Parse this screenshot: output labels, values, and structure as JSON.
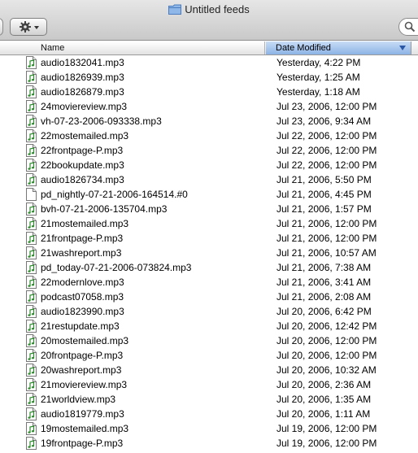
{
  "window": {
    "title": "Untitled feeds"
  },
  "toolbar": {
    "action_icon": "gear-icon",
    "search_icon": "search-icon"
  },
  "columns": {
    "name": "Name",
    "date_modified": "Date Modified",
    "sorted_by": "date_modified",
    "sort_direction": "descending"
  },
  "colors": {
    "sorted_column_header": "#8cb3e6",
    "audio_icon_accent": "#2e8b2e"
  },
  "files": [
    {
      "name": "audio1832041.mp3",
      "date": "Yesterday, 4:22 PM",
      "kind": "audio"
    },
    {
      "name": "audio1826939.mp3",
      "date": "Yesterday, 1:25 AM",
      "kind": "audio"
    },
    {
      "name": "audio1826879.mp3",
      "date": "Yesterday, 1:18 AM",
      "kind": "audio"
    },
    {
      "name": "24moviereview.mp3",
      "date": "Jul 23, 2006, 12:00 PM",
      "kind": "audio"
    },
    {
      "name": "vh-07-23-2006-093338.mp3",
      "date": "Jul 23, 2006, 9:34 AM",
      "kind": "audio"
    },
    {
      "name": "22mostemailed.mp3",
      "date": "Jul 22, 2006, 12:00 PM",
      "kind": "audio"
    },
    {
      "name": "22frontpage-P.mp3",
      "date": "Jul 22, 2006, 12:00 PM",
      "kind": "audio"
    },
    {
      "name": "22bookupdate.mp3",
      "date": "Jul 22, 2006, 12:00 PM",
      "kind": "audio"
    },
    {
      "name": "audio1826734.mp3",
      "date": "Jul 21, 2006, 5:50 PM",
      "kind": "audio"
    },
    {
      "name": "pd_nightly-07-21-2006-164514.#0",
      "date": "Jul 21, 2006, 4:45 PM",
      "kind": "document"
    },
    {
      "name": "bvh-07-21-2006-135704.mp3",
      "date": "Jul 21, 2006, 1:57 PM",
      "kind": "audio"
    },
    {
      "name": "21mostemailed.mp3",
      "date": "Jul 21, 2006, 12:00 PM",
      "kind": "audio"
    },
    {
      "name": "21frontpage-P.mp3",
      "date": "Jul 21, 2006, 12:00 PM",
      "kind": "audio"
    },
    {
      "name": "21washreport.mp3",
      "date": "Jul 21, 2006, 10:57 AM",
      "kind": "audio"
    },
    {
      "name": "pd_today-07-21-2006-073824.mp3",
      "date": "Jul 21, 2006, 7:38 AM",
      "kind": "audio"
    },
    {
      "name": "22modernlove.mp3",
      "date": "Jul 21, 2006, 3:41 AM",
      "kind": "audio"
    },
    {
      "name": "podcast07058.mp3",
      "date": "Jul 21, 2006, 2:08 AM",
      "kind": "audio"
    },
    {
      "name": "audio1823990.mp3",
      "date": "Jul 20, 2006, 6:42 PM",
      "kind": "audio"
    },
    {
      "name": "21restupdate.mp3",
      "date": "Jul 20, 2006, 12:42 PM",
      "kind": "audio"
    },
    {
      "name": "20mostemailed.mp3",
      "date": "Jul 20, 2006, 12:00 PM",
      "kind": "audio"
    },
    {
      "name": "20frontpage-P.mp3",
      "date": "Jul 20, 2006, 12:00 PM",
      "kind": "audio"
    },
    {
      "name": "20washreport.mp3",
      "date": "Jul 20, 2006, 10:32 AM",
      "kind": "audio"
    },
    {
      "name": "21moviereview.mp3",
      "date": "Jul 20, 2006, 2:36 AM",
      "kind": "audio"
    },
    {
      "name": "21worldview.mp3",
      "date": "Jul 20, 2006, 1:35 AM",
      "kind": "audio"
    },
    {
      "name": "audio1819779.mp3",
      "date": "Jul 20, 2006, 1:11 AM",
      "kind": "audio"
    },
    {
      "name": "19mostemailed.mp3",
      "date": "Jul 19, 2006, 12:00 PM",
      "kind": "audio"
    },
    {
      "name": "19frontpage-P.mp3",
      "date": "Jul 19, 2006, 12:00 PM",
      "kind": "audio"
    }
  ]
}
